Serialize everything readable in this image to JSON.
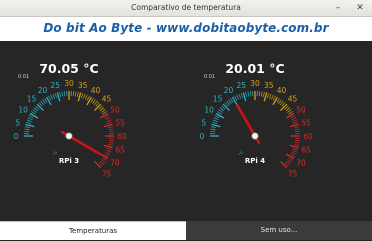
{
  "window": {
    "title": "Comparativo de temperatura",
    "minimize": "–",
    "close": "✕"
  },
  "banner": {
    "text": "Do bit Ao Byte - www.dobitaobyte.com.br"
  },
  "gauges": [
    {
      "reading": "70.05 °C",
      "value": 70.05,
      "label": "RPi 3",
      "corner": "0.01",
      "small_unit": "°C"
    },
    {
      "reading": "20.01 °C",
      "value": 20.01,
      "label": "RPi 4",
      "corner": "0.01",
      "small_unit": "°C"
    }
  ],
  "scale": {
    "min": 0,
    "max": 75,
    "ticks": [
      "0",
      "5",
      "10",
      "15",
      "20",
      "25",
      "30",
      "35",
      "40",
      "45",
      "50",
      "55",
      "60",
      "65",
      "70",
      "75"
    ]
  },
  "colors": {
    "cool": "#2ab3c2",
    "mid": "#d4a017",
    "hot": "#d42a2a",
    "needle": "#cc1414",
    "text": "#ffffff"
  },
  "tabs": [
    {
      "label": "Temperaturas",
      "active": true
    },
    {
      "label": "Sem uso...",
      "active": false
    }
  ]
}
